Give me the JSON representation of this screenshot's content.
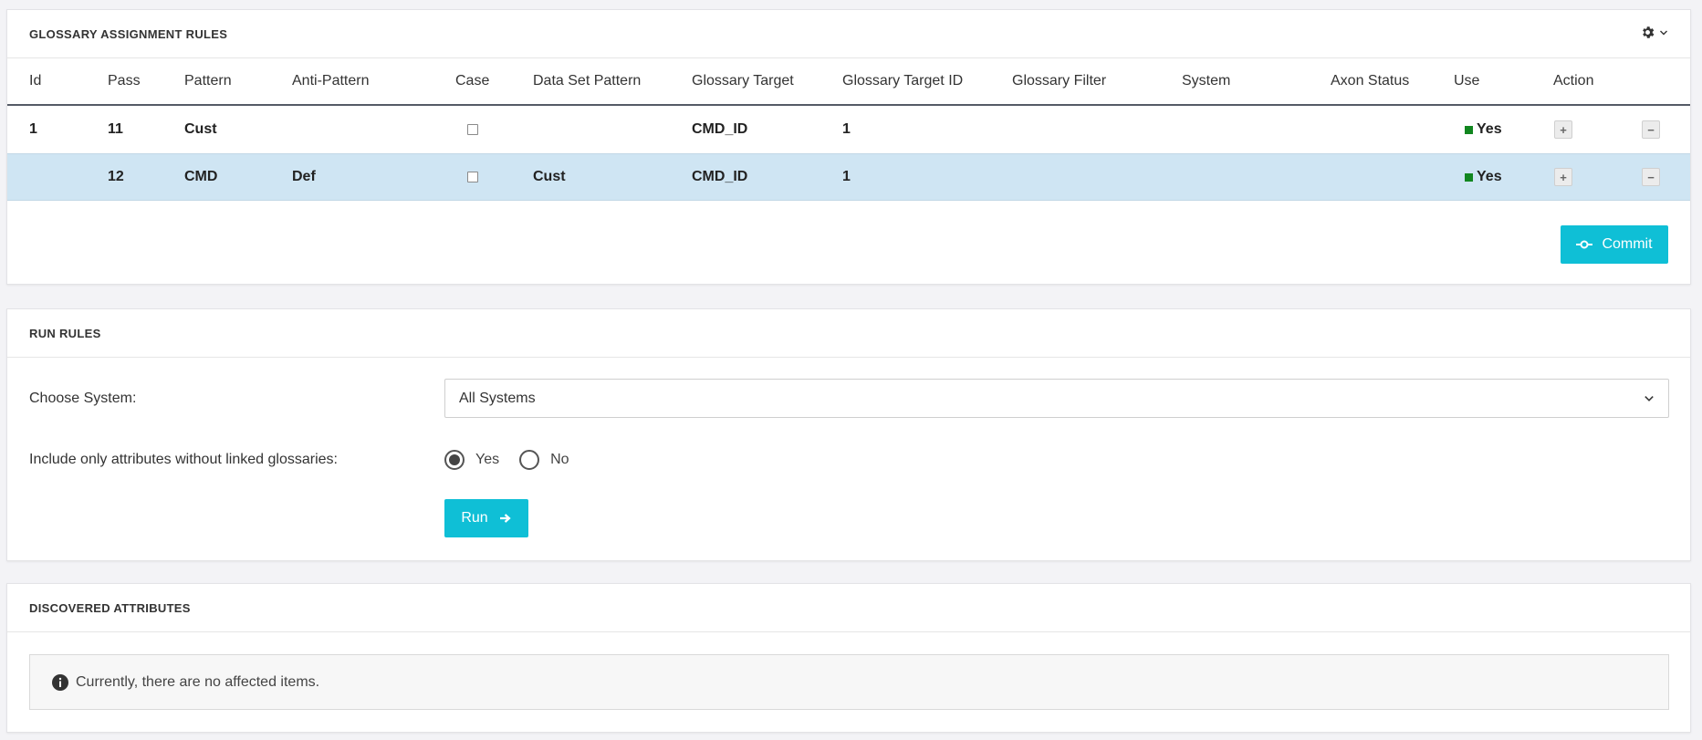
{
  "rules_panel": {
    "title": "GLOSSARY ASSIGNMENT RULES",
    "settings_icon": "gear-icon",
    "columns": [
      "Id",
      "Pass",
      "Pattern",
      "Anti-Pattern",
      "Case",
      "Data Set Pattern",
      "Glossary Target",
      "Glossary Target ID",
      "Glossary Filter",
      "System",
      "Axon Status",
      "Use",
      "Action"
    ],
    "rows": [
      {
        "id": "1",
        "pass": "11",
        "pattern": "Cust",
        "anti_pattern": "",
        "case": false,
        "data_set_pattern": "",
        "glossary_target": "CMD_ID",
        "glossary_target_id": "1",
        "glossary_filter": "",
        "system": "",
        "axon_status": "",
        "use": "Yes",
        "add": "+",
        "remove": "−"
      },
      {
        "id": "",
        "pass": "12",
        "pattern": "CMD",
        "anti_pattern": "Def",
        "case": false,
        "data_set_pattern": "Cust",
        "glossary_target": "CMD_ID",
        "glossary_target_id": "1",
        "glossary_filter": "",
        "system": "",
        "axon_status": "",
        "use": "Yes",
        "add": "+",
        "remove": "−"
      }
    ],
    "selected_row": 1,
    "use_color": "#11861f",
    "commit_label": "Commit",
    "commit_icon": "commit-icon"
  },
  "run_panel": {
    "title": "RUN RULES",
    "choose_system_label": "Choose System:",
    "system_value": "All Systems",
    "include_label": "Include only attributes without linked glossaries:",
    "radio_yes": "Yes",
    "radio_no": "No",
    "radio_selected": "Yes",
    "run_label": "Run",
    "run_icon": "arrow-right-icon"
  },
  "discovered_panel": {
    "title": "DISCOVERED ATTRIBUTES",
    "notice": "Currently, there are no affected items.",
    "notice_icon": "info-icon"
  },
  "accent_color": "#0fbfd6"
}
